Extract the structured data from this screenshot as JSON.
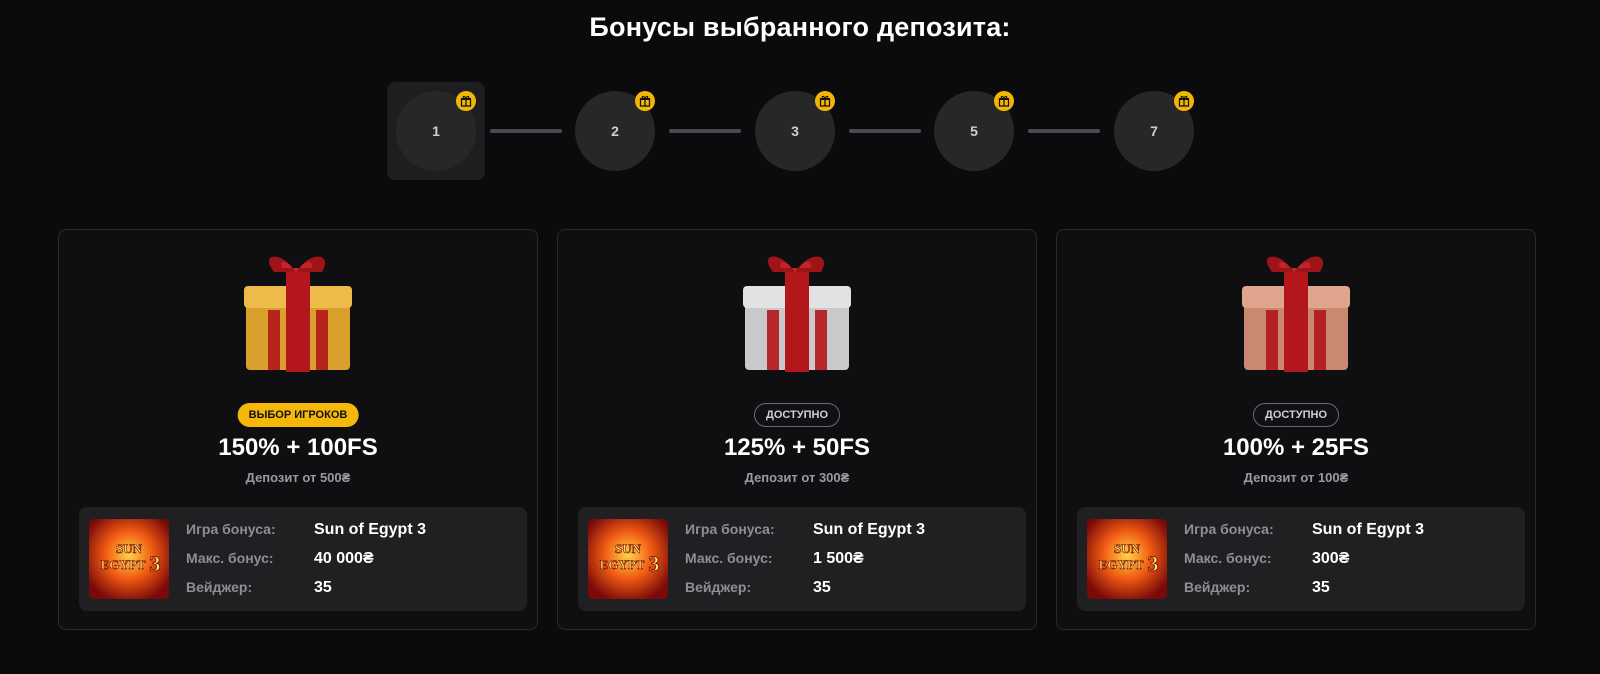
{
  "page": {
    "title": "Бонусы выбранного депозита:"
  },
  "stepper": {
    "steps": [
      {
        "label": "1",
        "active": true
      },
      {
        "label": "2",
        "active": false
      },
      {
        "label": "3",
        "active": false
      },
      {
        "label": "5",
        "active": false
      },
      {
        "label": "7",
        "active": false
      }
    ],
    "gift_icon": "gift-icon"
  },
  "labels": {
    "game": "Игра бонуса:",
    "max_bonus": "Макс. бонус:",
    "wager": "Вейджер:"
  },
  "cards": [
    {
      "badge": "ВЫБОР ИГРОКОВ",
      "badge_style": "gold",
      "amount": "150% + 100FS",
      "deposit": "Депозит от 500₴",
      "game": "Sun of Egypt 3",
      "max_bonus": "40 000₴",
      "wager": "35",
      "gift_color": "#d9a02e",
      "thumb_text": "SUN EGYPT 3"
    },
    {
      "badge": "ДОСТУПНО",
      "badge_style": "outline",
      "amount": "125% + 50FS",
      "deposit": "Депозит от 300₴",
      "game": "Sun of Egypt 3",
      "max_bonus": "1 500₴",
      "wager": "35",
      "gift_color": "#c9c9cc",
      "thumb_text": "SUN EGYPT 3"
    },
    {
      "badge": "ДОСТУПНО",
      "badge_style": "outline",
      "amount": "100% + 25FS",
      "deposit": "Депозит от 100₴",
      "game": "Sun of Egypt 3",
      "max_bonus": "300₴",
      "wager": "35",
      "gift_color": "#c98870",
      "thumb_text": "SUN EGYPT 3"
    }
  ],
  "colors": {
    "accent": "#f5b70a",
    "background": "#0b0b0d",
    "ribbon": "#b3161b"
  }
}
